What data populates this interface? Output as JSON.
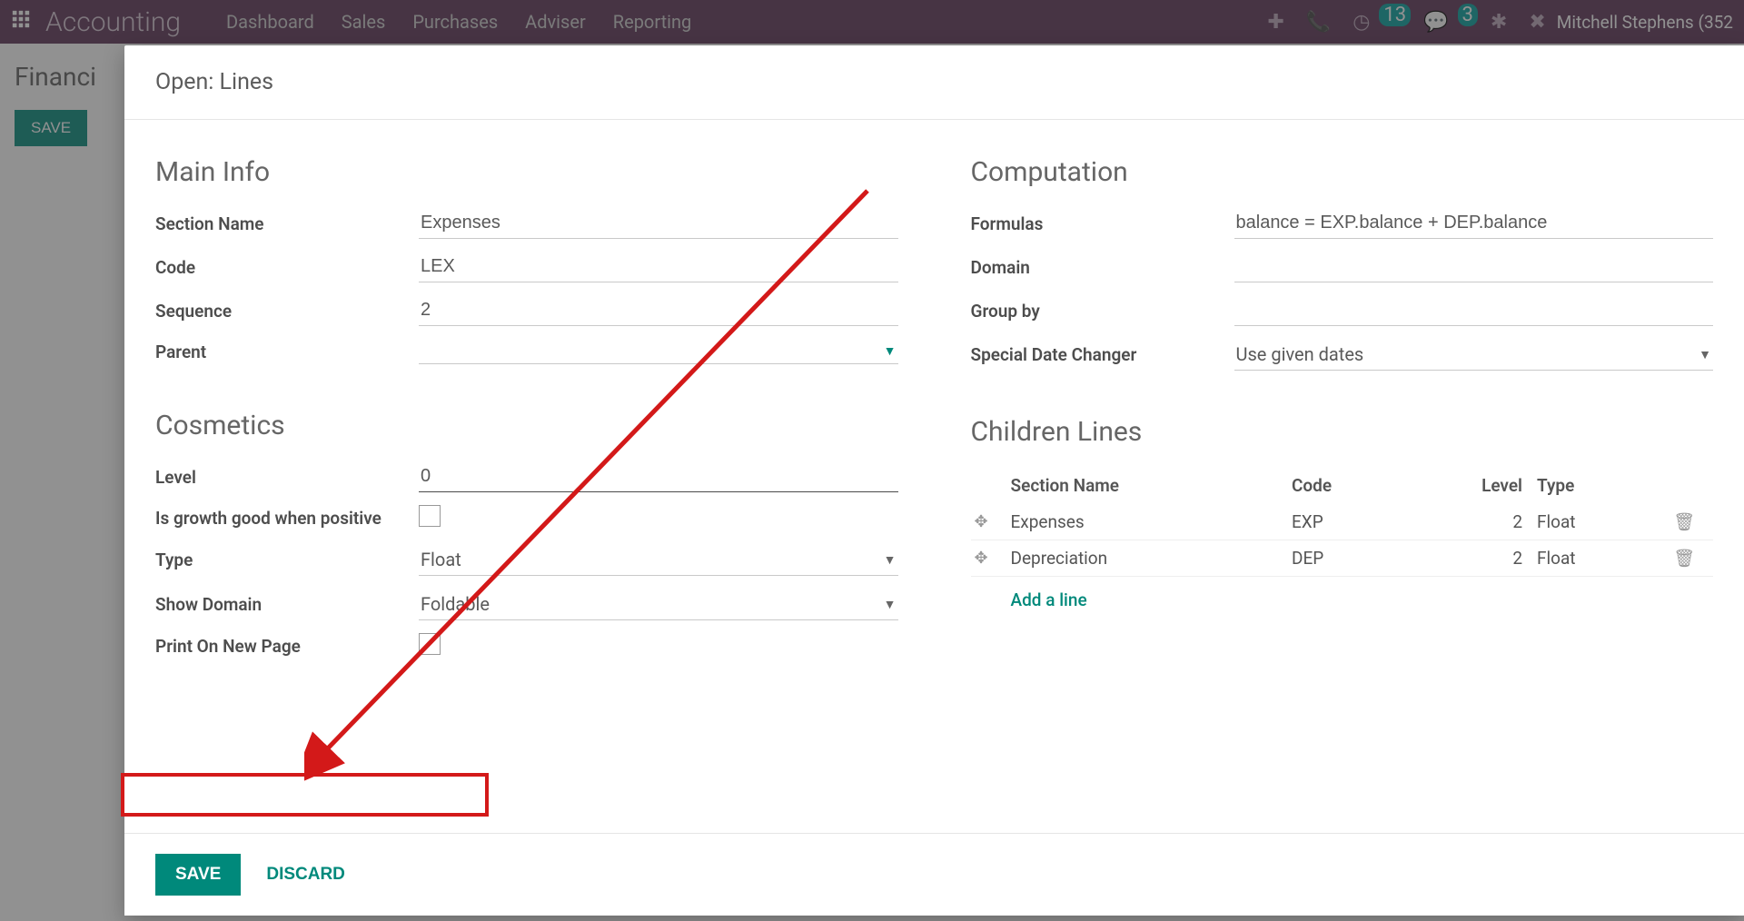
{
  "topbar": {
    "brand": "Accounting",
    "nav": [
      "Dashboard",
      "Sales",
      "Purchases",
      "Adviser",
      "Reporting"
    ],
    "badge_activities": "13",
    "badge_chat": "3",
    "user": "Mitchell Stephens (352"
  },
  "page": {
    "breadcrumb": "Financi",
    "save": "SAVE"
  },
  "modal": {
    "title": "Open: Lines",
    "save": "SAVE",
    "discard": "DISCARD"
  },
  "main_info": {
    "heading": "Main Info",
    "labels": {
      "section_name": "Section Name",
      "code": "Code",
      "sequence": "Sequence",
      "parent": "Parent"
    },
    "section_name": "Expenses",
    "code": "LEX",
    "sequence": "2",
    "parent": ""
  },
  "cosmetics": {
    "heading": "Cosmetics",
    "labels": {
      "level": "Level",
      "growth": "Is growth good when positive",
      "type": "Type",
      "show_domain": "Show Domain",
      "print": "Print On New Page"
    },
    "level": "0",
    "is_growth_good": false,
    "type": "Float",
    "show_domain": "Foldable",
    "print_on_new_page": false
  },
  "computation": {
    "heading": "Computation",
    "labels": {
      "formulas": "Formulas",
      "domain": "Domain",
      "group_by": "Group by",
      "special_date": "Special Date Changer"
    },
    "formulas": "balance = EXP.balance + DEP.balance",
    "domain": "",
    "group_by": "",
    "special_date": "Use given dates"
  },
  "children": {
    "heading": "Children Lines",
    "headers": {
      "section_name": "Section Name",
      "code": "Code",
      "level": "Level",
      "type": "Type"
    },
    "rows": [
      {
        "section_name": "Expenses",
        "code": "EXP",
        "level": "2",
        "type": "Float"
      },
      {
        "section_name": "Depreciation",
        "code": "DEP",
        "level": "2",
        "type": "Float"
      }
    ],
    "add": "Add a line"
  }
}
